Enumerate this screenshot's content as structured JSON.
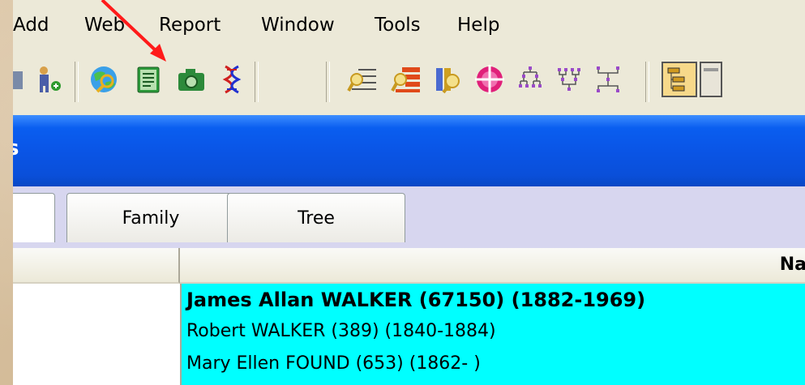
{
  "menu": {
    "items": [
      "Add",
      "Web",
      "Report",
      "Window",
      "Tools",
      "Help"
    ]
  },
  "toolbar": {
    "icons": [
      "partial-icon",
      "add-person-icon",
      "web-search-icon",
      "notebook-icon",
      "camera-icon",
      "dna-icon",
      "find-ancestors-icon",
      "find-descendants-icon",
      "family-search-icon",
      "target-icon",
      "ancestor-tree-icon",
      "descendant-tree-icon",
      "hourglass-tree-icon",
      "view-toggle-icon"
    ]
  },
  "tabs": [
    "Family",
    "Tree"
  ],
  "columns": {
    "name_header": "Na"
  },
  "people": [
    {
      "text": "James Allan WALKER (67150)  (1882-1969)",
      "bold": true
    },
    {
      "text": "Robert WALKER (389)  (1840-1884)",
      "bold": false
    },
    {
      "text": "Mary Ellen FOUND (653)  (1862-   )",
      "bold": false
    }
  ],
  "colors": {
    "titlebar": "#0a55e6",
    "selection": "#00ffff",
    "annotation_arrow": "#ff1a1a",
    "tab_strip": "#d7d6ef"
  }
}
